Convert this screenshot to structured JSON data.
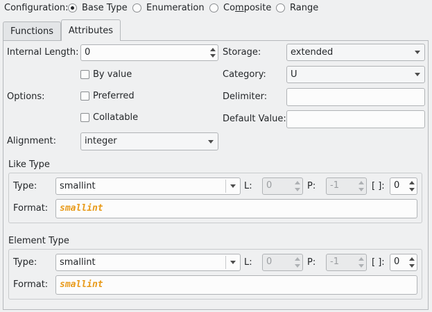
{
  "configuration": {
    "label": "Configuration:",
    "options": [
      {
        "label": "Base Type",
        "selected": true
      },
      {
        "label": "Enumeration",
        "selected": false
      },
      {
        "label": "Composite",
        "selected": false,
        "mnemonic": "m"
      },
      {
        "label": "Range",
        "selected": false
      }
    ]
  },
  "tabs": [
    {
      "label": "Functions",
      "active": false
    },
    {
      "label": "Attributes",
      "active": true
    }
  ],
  "attributes": {
    "internal_length": {
      "label": "Internal Length:",
      "value": "0"
    },
    "options_label": "Options:",
    "checkboxes": [
      {
        "label": "By value",
        "checked": false
      },
      {
        "label": "Preferred",
        "checked": false
      },
      {
        "label": "Collatable",
        "checked": false
      }
    ],
    "alignment": {
      "label": "Alignment:",
      "value": "integer"
    },
    "storage": {
      "label": "Storage:",
      "value": "extended"
    },
    "category": {
      "label": "Category:",
      "value": "U"
    },
    "delimiter": {
      "label": "Delimiter:",
      "value": ""
    },
    "default_value": {
      "label": "Default Value:",
      "value": ""
    }
  },
  "like_type": {
    "title": "Like Type",
    "type_label": "Type:",
    "type_value": "smallint",
    "l_label": "L:",
    "l_value": "0",
    "p_label": "P:",
    "p_value": "-1",
    "dim_label": "[ ]:",
    "dim_value": "0",
    "format_label": "Format:",
    "format_value": "smallint"
  },
  "element_type": {
    "title": "Element Type",
    "type_label": "Type:",
    "type_value": "smallint",
    "l_label": "L:",
    "l_value": "0",
    "p_label": "P:",
    "p_value": "-1",
    "dim_label": "[ ]:",
    "dim_value": "0",
    "format_label": "Format:",
    "format_value": "smallint"
  },
  "colors": {
    "format_text": "#e89a19",
    "background": "#eff0f1",
    "field_bg": "#fcfcfc"
  }
}
